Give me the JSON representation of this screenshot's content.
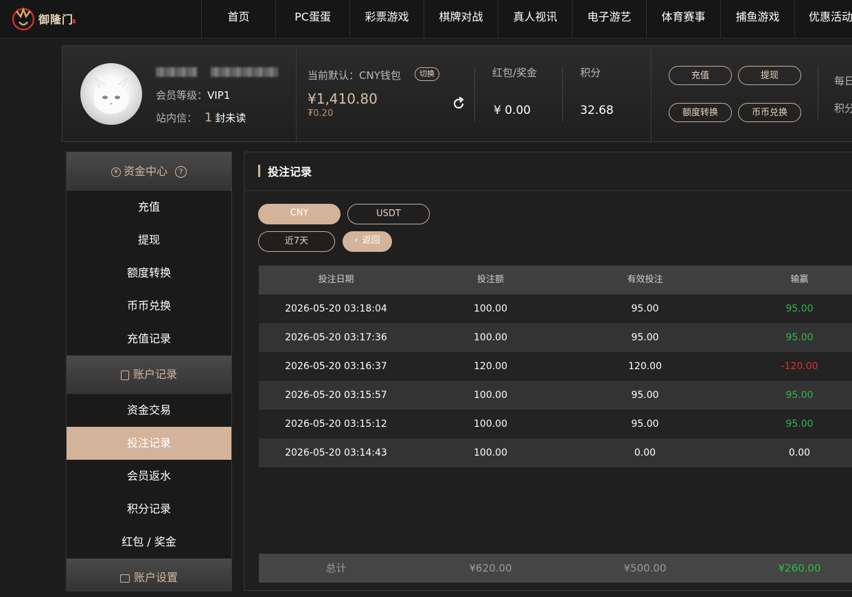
{
  "nav": {
    "logo_text": "御隆门",
    "items": [
      "首页",
      "PC蛋蛋",
      "彩票游戏",
      "棋牌对战",
      "真人视讯",
      "电子游艺",
      "体育赛事",
      "捕鱼游戏",
      "优惠活动"
    ]
  },
  "profile": {
    "level_label": "会员等级：",
    "level_value": "VIP1",
    "inbox_label": "站内信：",
    "inbox_count": "1",
    "inbox_suffix": "封未读",
    "default_label": "当前默认：CNY钱包",
    "switch_label": "切换",
    "balance": "¥1,410.80",
    "balance_sub": "₮0.20",
    "bonus_label": "红包/奖金",
    "bonus_value": "¥ 0.00",
    "points_label": "积分",
    "points_value": "32.68",
    "buttons": [
      "充值",
      "提现",
      "额度转换",
      "币币兑换"
    ],
    "right_labels": [
      "每日",
      "积分"
    ]
  },
  "sidebar": {
    "section1": "资金中心",
    "items1": [
      "充值",
      "提现",
      "额度转换",
      "币币兑换",
      "充值记录"
    ],
    "section2": "账户记录",
    "items2": [
      "资金交易",
      "投注记录",
      "会员返水",
      "积分记录",
      "红包 / 奖金"
    ],
    "section3": "账户设置",
    "active": "投注记录"
  },
  "main": {
    "title": "投注记录",
    "currency_tabs": [
      "CNY",
      "USDT"
    ],
    "range_label": "近7天",
    "back_label": "返回",
    "columns": [
      "投注日期",
      "投注额",
      "有效投注",
      "输赢"
    ],
    "rows": [
      [
        "2026-05-20 03:18:04",
        "100.00",
        "95.00",
        "95.00"
      ],
      [
        "2026-05-20 03:17:36",
        "100.00",
        "95.00",
        "95.00"
      ],
      [
        "2026-05-20 03:16:37",
        "120.00",
        "120.00",
        "-120.00"
      ],
      [
        "2026-05-20 03:15:57",
        "100.00",
        "95.00",
        "95.00"
      ],
      [
        "2026-05-20 03:15:12",
        "100.00",
        "95.00",
        "95.00"
      ],
      [
        "2026-05-20 03:14:43",
        "100.00",
        "0.00",
        "0.00"
      ]
    ],
    "total": [
      "总计",
      "¥620.00",
      "¥500.00",
      "¥260.00"
    ]
  },
  "colors": {
    "accent": "#d3b49a",
    "win": "#2db84a",
    "loss": "#e03030"
  }
}
